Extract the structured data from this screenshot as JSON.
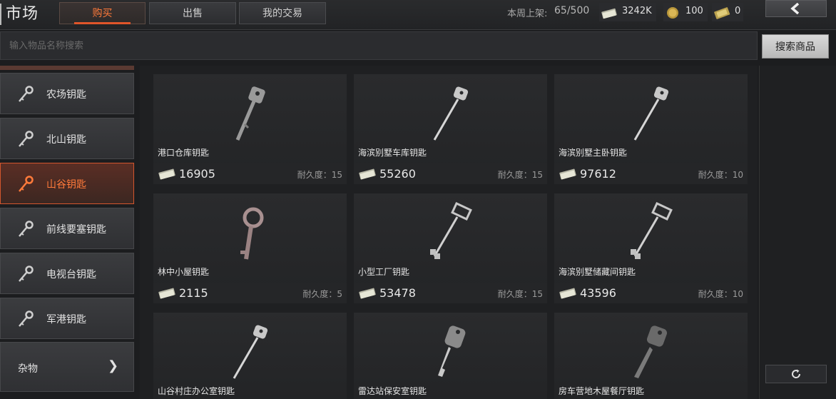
{
  "title": "市场",
  "tabs": [
    {
      "label": "购买",
      "active": true
    },
    {
      "label": "出售",
      "active": false
    },
    {
      "label": "我的交易",
      "active": false
    }
  ],
  "shelf": {
    "label": "本周上架:",
    "value": "65/500"
  },
  "currencies": [
    {
      "icon": "cash-stack-icon",
      "value": "3242K"
    },
    {
      "icon": "gold-coin-icon",
      "value": "100"
    },
    {
      "icon": "voucher-icon",
      "value": "0"
    }
  ],
  "search": {
    "placeholder": "输入物品名称搜索",
    "button_label": "搜索商品"
  },
  "sidebar": {
    "items": [
      {
        "label": "农场钥匙",
        "active": false
      },
      {
        "label": "北山钥匙",
        "active": false
      },
      {
        "label": "山谷钥匙",
        "active": true
      },
      {
        "label": "前线要塞钥匙",
        "active": false
      },
      {
        "label": "电视台钥匙",
        "active": false
      },
      {
        "label": "军港钥匙",
        "active": false
      }
    ],
    "misc_label": "杂物"
  },
  "items": [
    {
      "name": "港口仓库钥匙",
      "price": "16905",
      "durability": "耐久度：15",
      "key_style": "gray"
    },
    {
      "name": "海滨别墅车库钥匙",
      "price": "55260",
      "durability": "耐久度：15",
      "key_style": "silver"
    },
    {
      "name": "海滨别墅主卧钥匙",
      "price": "97612",
      "durability": "耐久度：10",
      "key_style": "silver"
    },
    {
      "name": "林中小屋钥匙",
      "price": "2115",
      "durability": "耐久度：5",
      "key_style": "rusty"
    },
    {
      "name": "小型工厂钥匙",
      "price": "53478",
      "durability": "耐久度：15",
      "key_style": "skeleton"
    },
    {
      "name": "海滨别墅储藏间钥匙",
      "price": "43596",
      "durability": "耐久度：10",
      "key_style": "skeleton"
    },
    {
      "name": "山谷村庄办公室钥匙",
      "price": "",
      "durability": "",
      "key_style": "silver"
    },
    {
      "name": "雷达站保安室钥匙",
      "price": "",
      "durability": "",
      "key_style": "flat"
    },
    {
      "name": "房车营地木屋餐厅钥匙",
      "price": "",
      "durability": "",
      "key_style": "dark"
    }
  ],
  "colors": {
    "accent": "#e0552a",
    "accent_text": "#ff7a3a"
  }
}
